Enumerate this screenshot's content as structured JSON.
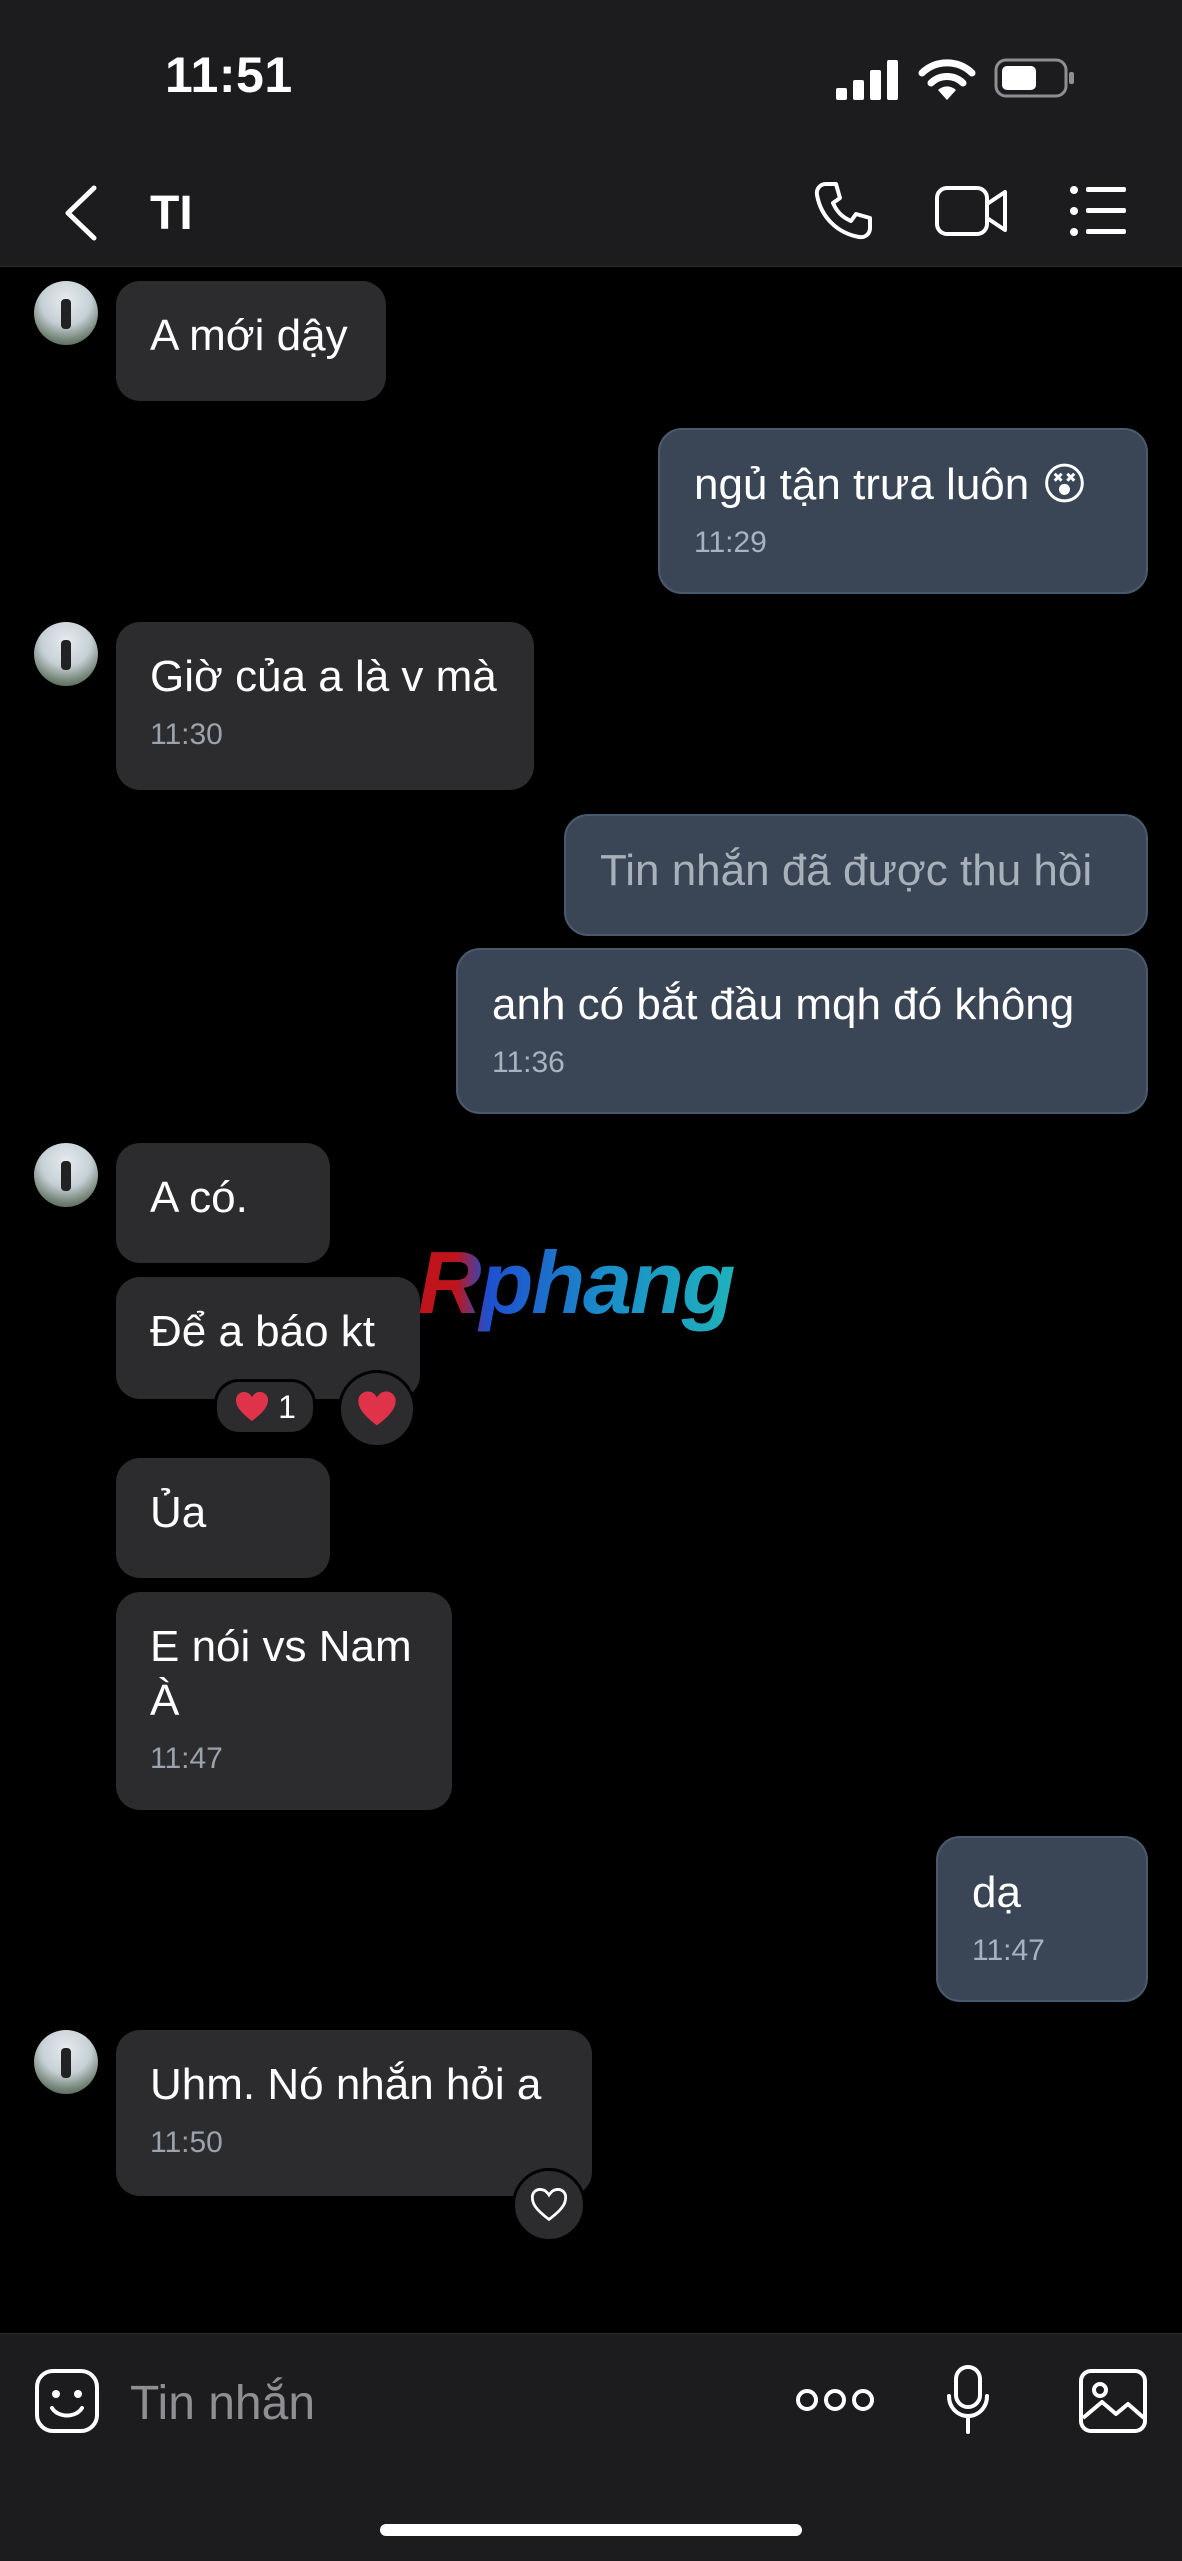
{
  "status_bar": {
    "time": "11:51"
  },
  "header": {
    "contact_name": "TI"
  },
  "colors": {
    "incoming_bubble": "#2c2c2e",
    "outgoing_bubble": "#3a4655",
    "heart": "#e0334a"
  },
  "messages": [
    {
      "side": "in",
      "text": "A mới dậy",
      "time": ""
    },
    {
      "side": "out",
      "text": "ngủ tận trưa luôn",
      "emoji": "😵",
      "time": "11:29"
    },
    {
      "side": "in",
      "text": "Giờ của a là v mà",
      "time": "11:30"
    },
    {
      "side": "out",
      "text": "Tin nhắn đã được thu hồi",
      "recalled": true,
      "time": ""
    },
    {
      "side": "out",
      "text": "anh có bắt đầu mqh đó không",
      "time": "11:36"
    },
    {
      "side": "in",
      "text": "A có.",
      "time": ""
    },
    {
      "side": "in",
      "text": "Để a báo kt",
      "time": "",
      "reaction": {
        "icon": "heart-icon",
        "count": "1"
      }
    },
    {
      "side": "in",
      "text": "Ủa",
      "time": ""
    },
    {
      "side": "in",
      "text": "E nói vs Nam\nÀ",
      "time": "11:47"
    },
    {
      "side": "out",
      "text": "dạ",
      "time": "11:47"
    },
    {
      "side": "in",
      "text": "Uhm. Nó nhắn hỏi a",
      "time": "11:50"
    }
  ],
  "watermark": "Rphang",
  "composer": {
    "placeholder": "Tin nhắn"
  }
}
